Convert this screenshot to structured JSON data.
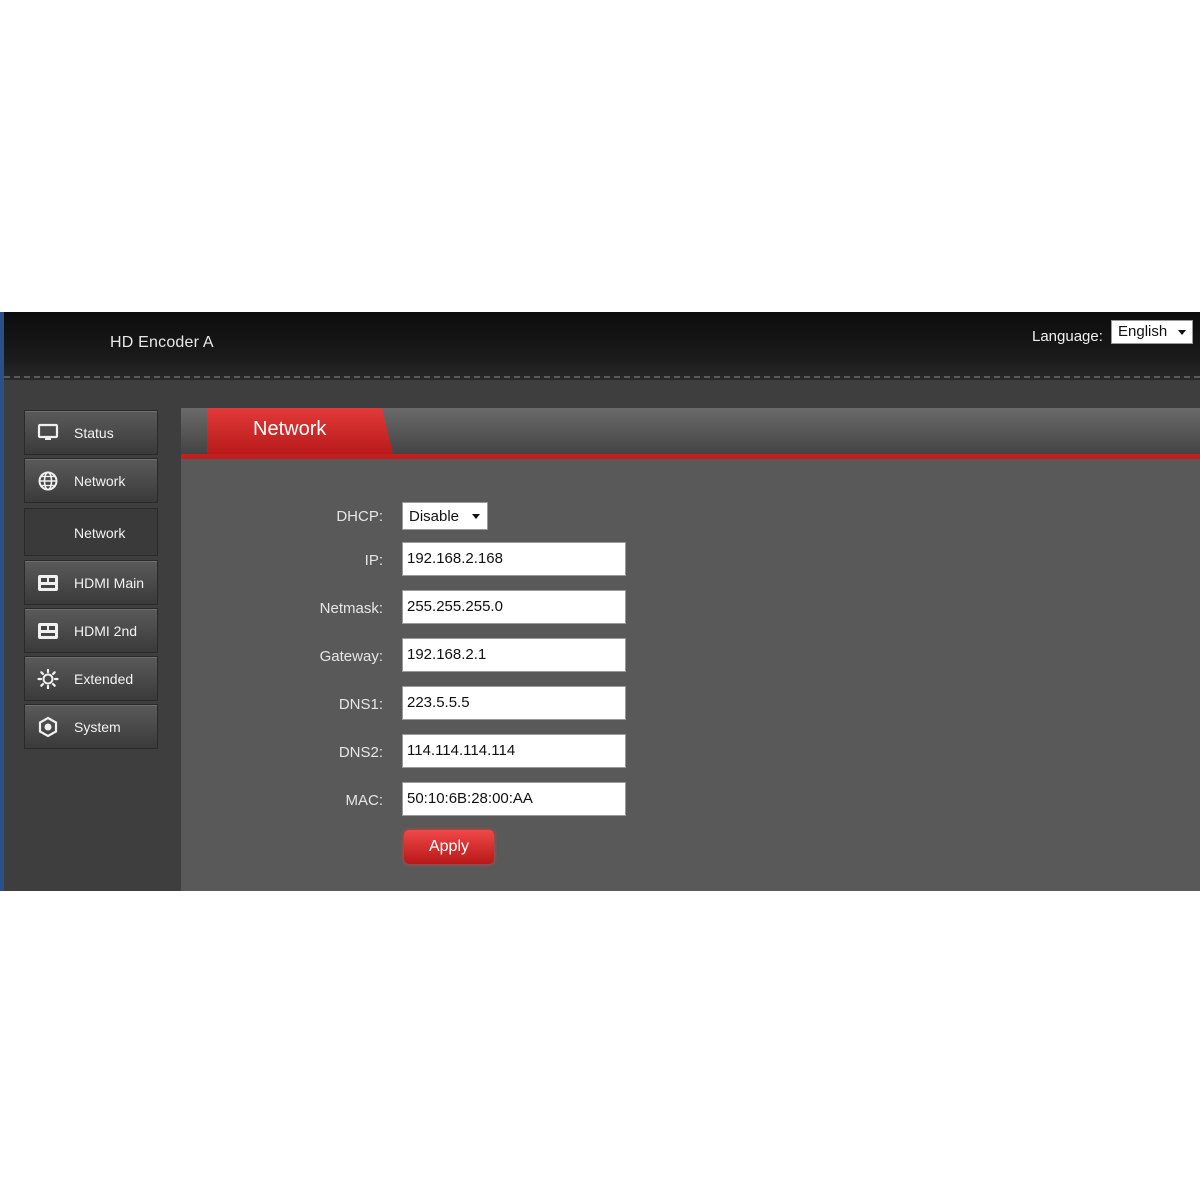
{
  "header": {
    "title": "HD Encoder  A",
    "language_label": "Language:",
    "language_value": "English"
  },
  "sidebar": {
    "items": [
      {
        "label": "Status",
        "icon": "monitor-icon"
      },
      {
        "label": "Network",
        "icon": "globe-icon"
      },
      {
        "label": "Network",
        "icon": ""
      },
      {
        "label": "HDMI Main",
        "icon": "hdmi-port-icon"
      },
      {
        "label": "HDMI 2nd",
        "icon": "hdmi-port-icon"
      },
      {
        "label": "Extended",
        "icon": "gear-icon"
      },
      {
        "label": "System",
        "icon": "settings-icon"
      }
    ]
  },
  "main": {
    "tab_label": "Network",
    "fields": {
      "dhcp": {
        "label": "DHCP:",
        "value": "Disable"
      },
      "ip": {
        "label": "IP:",
        "value": "192.168.2.168"
      },
      "netmask": {
        "label": "Netmask:",
        "value": "255.255.255.0"
      },
      "gateway": {
        "label": "Gateway:",
        "value": "192.168.2.1"
      },
      "dns1": {
        "label": "DNS1:",
        "value": "223.5.5.5"
      },
      "dns2": {
        "label": "DNS2:",
        "value": "114.114.114.114"
      },
      "mac": {
        "label": "MAC:",
        "value": "50:10:6B:28:00:AA"
      }
    },
    "apply_label": "Apply"
  },
  "colors": {
    "accent": "#c41e1e",
    "header_bg": "#111111",
    "panel_bg": "#595959"
  }
}
